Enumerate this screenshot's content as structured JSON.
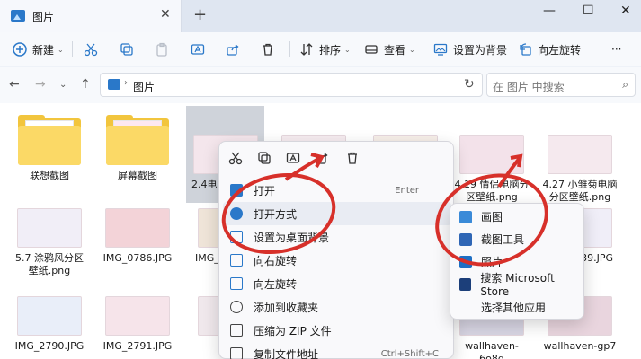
{
  "window": {
    "tab_title": "图片",
    "tab_close": "✕",
    "new_tab": "+",
    "minimize": "—",
    "maximize": "☐",
    "close": "✕"
  },
  "toolbar": {
    "new_label": "新建",
    "sort_label": "排序",
    "view_label": "查看",
    "set_bg_label": "设置为背景",
    "rotate_left_label": "向左旋转",
    "more": "···"
  },
  "address": {
    "crumb": "图片",
    "search_placeholder": "在 图片 中搜索"
  },
  "files": [
    {
      "name": "联想截图",
      "kind": "folder"
    },
    {
      "name": "屏幕截图",
      "kind": "folder"
    },
    {
      "name": "2.4电脑",
      "kind": "image"
    },
    {
      "name": "",
      "kind": "image"
    },
    {
      "name": "",
      "kind": "image"
    },
    {
      "name": "4.19 情侣电脑分区壁纸.png",
      "kind": "image"
    },
    {
      "name": "4.27 小雏菊电脑分区壁纸.png",
      "kind": "image"
    },
    {
      "name": "5.7 涂鸦风分区壁纸.png",
      "kind": "image"
    },
    {
      "name": "IMG_0786.JPG",
      "kind": "image"
    },
    {
      "name": "IMG_",
      "kind": "image"
    },
    {
      "name": "",
      "kind": "image"
    },
    {
      "name": "",
      "kind": "image"
    },
    {
      "name": "",
      "kind": "image"
    },
    {
      "name": "39.JPG",
      "kind": "image"
    },
    {
      "name": "IMG_2790.JPG",
      "kind": "image"
    },
    {
      "name": "IMG_2791.JPG",
      "kind": "image"
    },
    {
      "name": "",
      "kind": "image"
    },
    {
      "name": "",
      "kind": "image"
    },
    {
      "name": "",
      "kind": "image"
    },
    {
      "name": "wallhaven-6o8q",
      "kind": "image"
    },
    {
      "name": "wallhaven-gp7",
      "kind": "image"
    }
  ],
  "context_menu": {
    "items": [
      {
        "label": "打开",
        "shortcut": "Enter"
      },
      {
        "label": "打开方式",
        "arrow": "›"
      },
      {
        "label": "设置为桌面背景"
      },
      {
        "label": "向右旋转"
      },
      {
        "label": "向左旋转"
      },
      {
        "label": "添加到收藏夹"
      },
      {
        "label": "压缩为 ZIP 文件"
      },
      {
        "label": "复制文件地址",
        "shortcut": "Ctrl+Shift+C"
      }
    ]
  },
  "open_with_menu": {
    "items": [
      {
        "label": "画图"
      },
      {
        "label": "截图工具"
      },
      {
        "label": "照片"
      },
      {
        "label": "搜索 Microsoft Store"
      },
      {
        "label": "选择其他应用"
      }
    ]
  },
  "colors": {
    "accent": "#2a78c9",
    "annotation": "#d7302a",
    "folder": "#f2c53d"
  }
}
